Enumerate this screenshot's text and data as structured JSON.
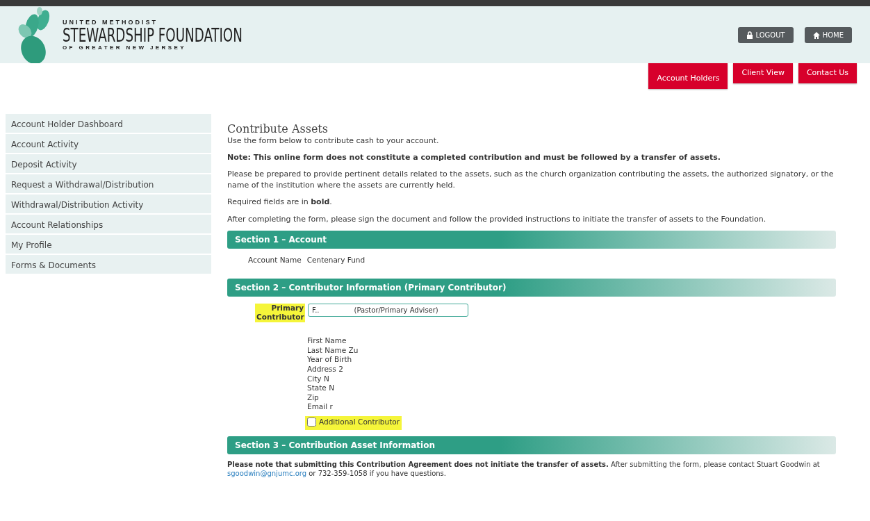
{
  "header": {
    "logo_line1": "UNITED METHODIST",
    "logo_line2": "STEWARDSHIP FOUNDATION",
    "logo_line3": "OF GREATER NEW JERSEY",
    "buttons": [
      {
        "label": "LOGOUT",
        "kind": "lock"
      },
      {
        "label": "HOME",
        "kind": "home"
      }
    ]
  },
  "nav": [
    {
      "label": "Account Holders",
      "selected": true
    },
    {
      "label": "Client View",
      "selected": false
    },
    {
      "label": "Contact Us",
      "selected": false
    }
  ],
  "sidebar": {
    "items": [
      "Account Holder Dashboard",
      "Account Activity",
      "Deposit Activity",
      "Request a Withdrawal/Distribution",
      "Withdrawal/Distribution Activity",
      "Account Relationships",
      "My Profile",
      "Forms & Documents"
    ]
  },
  "page": {
    "title": "Contribute Assets",
    "intro": "Use the form below to contribute cash to your account.",
    "note": "Note: This online form does not constitute a completed contribution and must be followed by a transfer of assets.",
    "paragraph": "Please be prepared to provide pertinent details related to the assets, such as the church organization contributing the assets, the authorized signatory, or the name of the institution where the assets are currently held.",
    "required": "Required fields are in **bold**.",
    "after": "After completing the form, please sign the document and follow the provided instructions to initiate the transfer of assets to the Foundation."
  },
  "sections": [
    {
      "title": "Section 1 – Account",
      "kind": "account",
      "label": "Account Name",
      "value": "Centenary Fund"
    },
    {
      "title": "Section 2 – Contributor Information (Primary Contributor)",
      "kind": "contributor",
      "label": "Primary Contributor",
      "select_value": "F..",
      "select_role": "(Pastor/Primary Adviser)",
      "details": [
        "First Name",
        "Last Name Zu",
        "Year of Birth",
        "Address 2",
        "City N",
        "State N",
        "Zip",
        "Email r"
      ],
      "checkbox": {
        "label": "Additional Contributor",
        "checked": false
      }
    },
    {
      "title": "Section 3 – Contribution Asset Information",
      "kind": "asset",
      "note_bold": "Please note that submitting this Contribution Agreement does not initiate the transfer of assets.",
      "note": "After submitting the form, please contact Stuart Goodwin at",
      "email": "sgoodwin@gnjumc.org",
      "rest": "or 732-359-1058 if you have questions."
    }
  ]
}
